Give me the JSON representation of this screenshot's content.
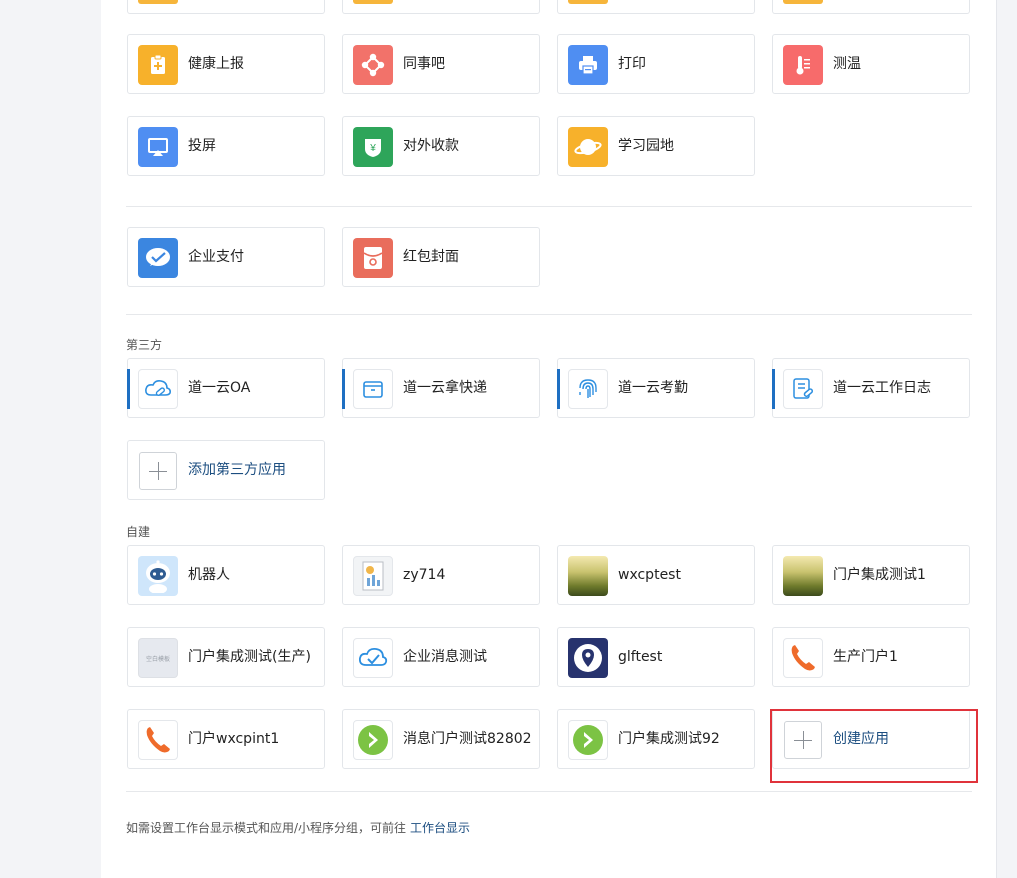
{
  "top_apps": [
    {
      "label": "健康上报",
      "icon": "health-report-icon",
      "color": "#f7b12b"
    },
    {
      "label": "同事吧",
      "icon": "colleague-icon",
      "color": "#f2726a"
    },
    {
      "label": "打印",
      "icon": "printer-icon",
      "color": "#4f8ef2"
    },
    {
      "label": "测温",
      "icon": "thermometer-icon",
      "color": "#f76b6b"
    },
    {
      "label": "投屏",
      "icon": "screen-cast-icon",
      "color": "#4f8ef2"
    },
    {
      "label": "对外收款",
      "icon": "payment-shield-icon",
      "color": "#2ea55a"
    },
    {
      "label": "学习园地",
      "icon": "planet-icon",
      "color": "#f7b12b"
    }
  ],
  "pay_apps": [
    {
      "label": "企业支付",
      "icon": "enterprise-pay-icon",
      "color": "#3b86e0"
    },
    {
      "label": "红包封面",
      "icon": "red-packet-icon",
      "color": "#e96d5c"
    }
  ],
  "third_party": {
    "title": "第三方",
    "apps": [
      {
        "label": "道一云OA",
        "icon": "cloud-oa-icon"
      },
      {
        "label": "道一云拿快递",
        "icon": "box-icon"
      },
      {
        "label": "道一云考勤",
        "icon": "fingerprint-icon"
      },
      {
        "label": "道一云工作日志",
        "icon": "work-log-icon"
      }
    ],
    "add_label": "添加第三方应用"
  },
  "self_built": {
    "title": "自建",
    "apps": [
      {
        "label": "机器人",
        "icon": "robot-icon"
      },
      {
        "label": "zy714",
        "icon": "report-chart-icon"
      },
      {
        "label": "wxcptest",
        "icon": "landscape-photo-icon"
      },
      {
        "label": "门户集成测试1",
        "icon": "landscape-photo-icon"
      },
      {
        "label": "门户集成测试(生产)",
        "icon": "placeholder-image-icon",
        "placeholder_text": "空白模板"
      },
      {
        "label": "企业消息测试",
        "icon": "cloud-check-icon"
      },
      {
        "label": "glftest",
        "icon": "location-pin-icon"
      },
      {
        "label": "生产门户1",
        "icon": "phone-icon"
      },
      {
        "label": "门户wxcpint1",
        "icon": "phone-icon"
      },
      {
        "label": "消息门户测试82802",
        "icon": "green-arrow-icon"
      },
      {
        "label": "门户集成测试92",
        "icon": "green-arrow-icon"
      }
    ],
    "create_label": "创建应用"
  },
  "footer": {
    "text": "如需设置工作台显示模式和应用/小程序分组，可前往",
    "link": "工作台显示"
  },
  "colors": {
    "highlight": "#e0333b",
    "link": "#1c4e80",
    "accent": "#1e6fc2"
  }
}
